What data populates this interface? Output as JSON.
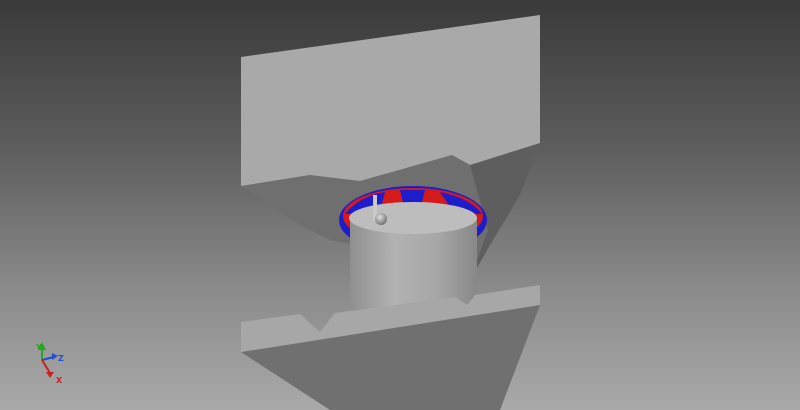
{
  "viewport": {
    "background_top": "#3a3a3a",
    "background_bottom": "#a9a9a9"
  },
  "model": {
    "plate_face_color": "#a9a9a9",
    "plate_side_color": "#6f6f6f",
    "cylinder_color": "#a3a3a3",
    "ring_color_primary": "#1d1dcc",
    "ring_color_secondary": "#d41a1a"
  },
  "triad": {
    "x_label": "X",
    "y_label": "Y",
    "z_label": "Z",
    "x_color": "#cc2020",
    "y_color": "#20aa20",
    "z_color": "#2050d0"
  }
}
